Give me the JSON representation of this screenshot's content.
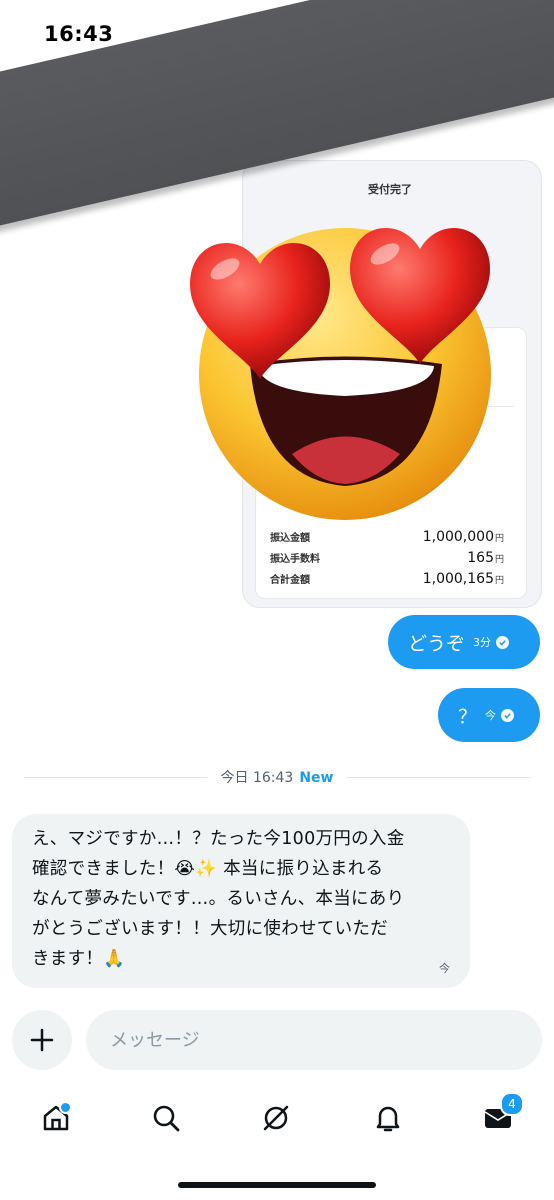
{
  "status_bar": {
    "time": "16:43"
  },
  "receipt": {
    "status": "受付完了",
    "rows": [
      {
        "label": "振込金額",
        "amount": "1,000,000",
        "unit": "円"
      },
      {
        "label": "振込手数料",
        "amount": "165",
        "unit": "円"
      },
      {
        "label": "合計金額",
        "amount": "1,000,165",
        "unit": "円"
      }
    ]
  },
  "messages_out": [
    {
      "text": "どうぞ",
      "time": "3分"
    },
    {
      "text": "？",
      "time": "今"
    }
  ],
  "date_separator": {
    "label": "今日 16:43",
    "new_label": "New"
  },
  "message_in": {
    "text": "え、マジですか…！？たった今100万円の入金\n確認できました！😭✨ 本当に振り込まれる\nなんて夢みたいです…。るいさん、本当にあり\nがとうございます！！大切に使わせていただ\nきます！🙏",
    "time": "今"
  },
  "composer": {
    "placeholder": "メッセージ"
  },
  "nav": {
    "messages_badge": "4"
  },
  "colors": {
    "accent": "#1d9bf0",
    "bubble_in": "#eff3f4",
    "band": "#545558"
  }
}
